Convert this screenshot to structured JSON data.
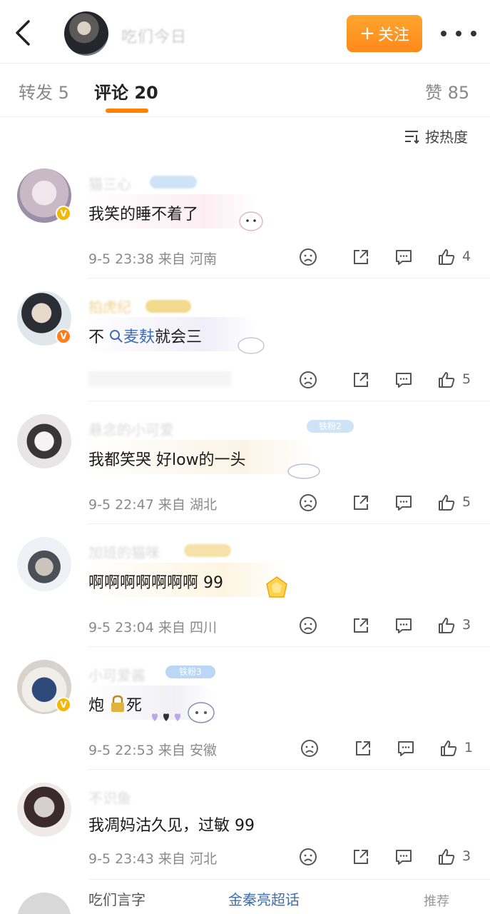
{
  "header": {
    "back_icon": "chevron-left-icon",
    "username": "吃们今日",
    "follow_label": "关注",
    "more_icon": "more-dots-icon"
  },
  "tabs": [
    {
      "label": "转发",
      "count": "5"
    },
    {
      "label": "评论",
      "count": "20"
    },
    {
      "label": "赞",
      "count": "85"
    }
  ],
  "sort_label": "按热度",
  "comments": [
    {
      "name": "猫三心",
      "text": "我笑的睡不着了",
      "time": "9-5 23:38",
      "from": "来自",
      "location": "河南",
      "likes": "4"
    },
    {
      "name": "拍虎纪",
      "text_pre": "不",
      "search_word": "麦麸",
      "text_post": "就会三",
      "time": "",
      "from": "",
      "location": "",
      "likes": "5"
    },
    {
      "name": "悬念的小可爱",
      "badge_text": "铁粉2",
      "text": "我都笑哭 好low的一头",
      "time": "9-5 22:47",
      "from": "来自",
      "location": "湖北",
      "likes": "5"
    },
    {
      "name": "加班的猫咪",
      "text": "啊啊啊啊啊啊啊 99",
      "time": "9-5 23:04",
      "from": "来自",
      "location": "四川",
      "likes": "3"
    },
    {
      "name": "小可爱酱",
      "badge_text": "铁粉3",
      "text_pre": "炮",
      "text_post": "死",
      "time": "9-5 22:53",
      "from": "来自",
      "location": "安徽",
      "likes": "1"
    },
    {
      "name": "不识鱼",
      "text": "我凋妈沽久见，过敏 99",
      "time": "9-5 23:43",
      "from": "来自",
      "location": "河北",
      "likes": "3"
    }
  ],
  "partial_comment": {
    "name": "吃们言字",
    "tag": "金秦亮超话",
    "right": "推荐"
  },
  "colors": {
    "accent": "#ff8200",
    "follow_bg": "#ff9a22",
    "link": "#3f6fb3",
    "meta": "#8a8a8a"
  }
}
